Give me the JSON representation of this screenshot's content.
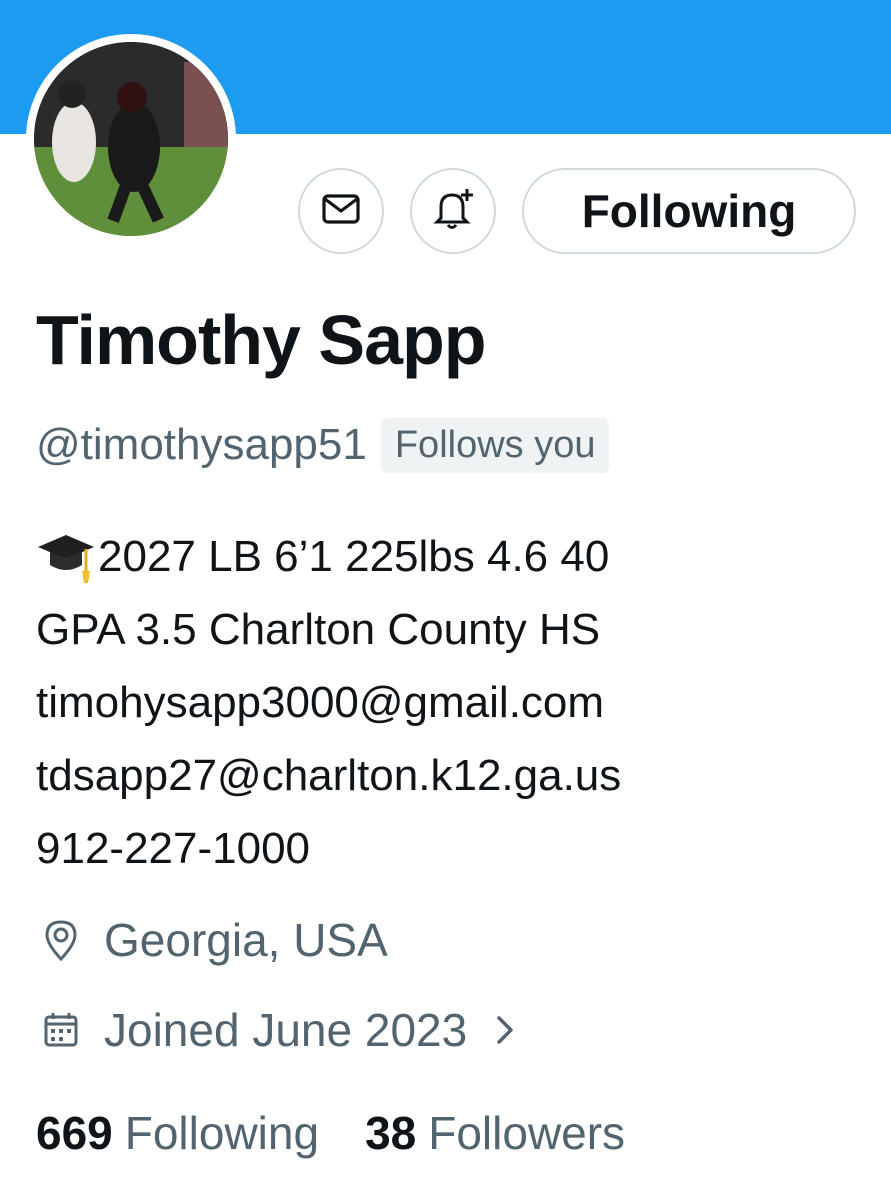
{
  "profile": {
    "name": "Timothy Sapp",
    "handle": "@timothysapp51",
    "follows_you_badge": "Follows you",
    "follow_button_label": "Following",
    "bio": [
      "2027 LB 6’1 225lbs 4.6 40",
      "GPA 3.5 Charlton County HS",
      "timohysapp3000@gmail.com",
      "tdsapp27@charlton.k12.ga.us",
      "912-227-1000"
    ],
    "bio_emoji_icon": "graduation-cap-icon",
    "location": "Georgia, USA",
    "joined": "Joined June 2023",
    "following_count": "669",
    "following_label": "Following",
    "followers_count": "38",
    "followers_label": "Followers"
  },
  "icons": {
    "message": "mail-icon",
    "notify": "bell-plus-icon",
    "location": "location-pin-icon",
    "calendar": "calendar-icon",
    "chevron": "chevron-right-icon"
  },
  "colors": {
    "banner": "#1d9bf0",
    "text_primary": "#0f1419",
    "text_secondary": "#536471",
    "border": "#cfd9de"
  }
}
